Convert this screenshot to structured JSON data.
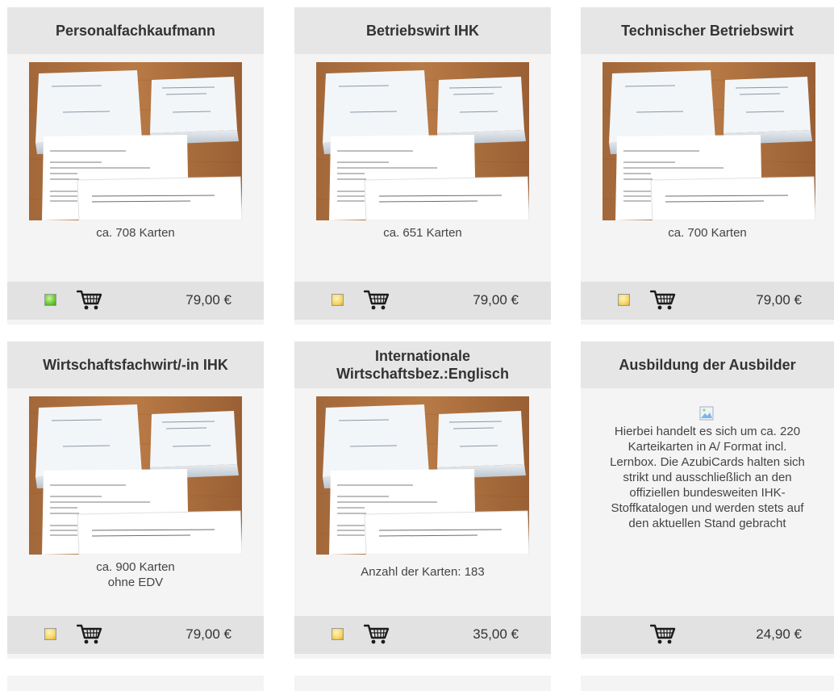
{
  "products": [
    {
      "title": "Personalfachkaufmann",
      "caption": "ca. 708 Karten",
      "indicator": "green",
      "price": "79,00 €"
    },
    {
      "title": "Betriebswirt IHK",
      "caption": "ca. 651 Karten",
      "indicator": "yellow",
      "price": "79,00 €"
    },
    {
      "title": "Technischer Betriebswirt",
      "caption": "ca. 700 Karten",
      "indicator": "yellow",
      "price": "79,00 €"
    },
    {
      "title": "Wirtschaftsfachwirt/-in IHK",
      "caption_line1": "ca. 900 Karten",
      "caption_line2": "ohne EDV",
      "indicator": "yellow",
      "price": "79,00 €"
    },
    {
      "title_line1": "Internationale",
      "title_line2": "Wirtschaftsbez.:Englisch",
      "caption": "Anzahl der Karten: 183",
      "indicator": "yellow",
      "price": "35,00 €"
    },
    {
      "title": "Ausbildung der Ausbilder",
      "description_lines": [
        "Hierbei handelt es sich um ca. 220",
        "Karteikarten in A/ Format incl.",
        "Lernbox. Die AzubiCards halten sich",
        "strikt und ausschließlich an den",
        "offiziellen bundesweiten IHK-",
        "Stoffkatalogen und werden stets auf",
        "den aktuellen Stand gebracht"
      ],
      "price": "24,90 €"
    }
  ],
  "colors": {
    "card_bg": "#f4f4f4",
    "header_bg": "#e6e6e6",
    "footer_bg": "#e2e2e2",
    "available": "#6cc838",
    "limited": "#f5d66a"
  },
  "icons": [
    "cart-icon",
    "availability-indicator-icon",
    "broken-image-icon"
  ]
}
